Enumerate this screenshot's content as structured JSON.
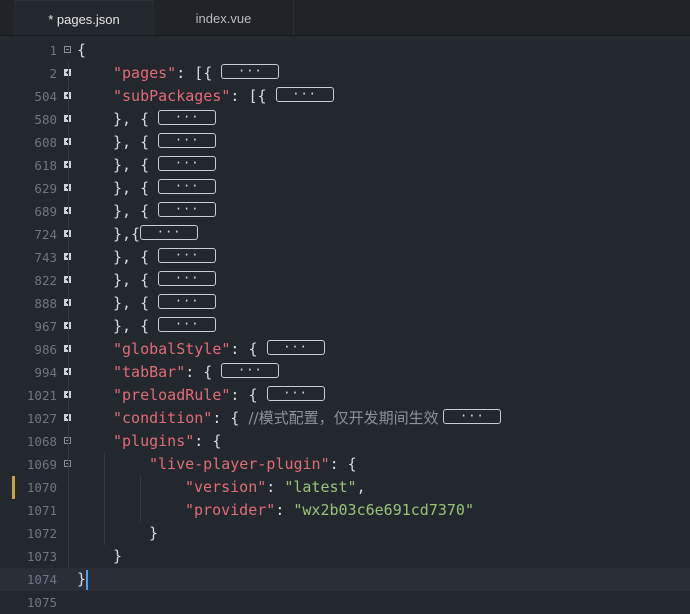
{
  "tabs": [
    {
      "label": "* pages.json",
      "active": true
    },
    {
      "label": "index.vue",
      "active": false
    }
  ],
  "colors": {
    "key": "#e06c75",
    "string": "#98c379",
    "comment": "#8b919b",
    "punct": "#d7dae0",
    "background": "#23272e"
  },
  "fold_placeholder": "···",
  "lines": [
    {
      "num": "1",
      "fold": "minus",
      "indent": 0,
      "parts": [
        {
          "t": "{",
          "c": "p"
        }
      ]
    },
    {
      "num": "2",
      "fold": "plus",
      "indent": 1,
      "parts": [
        {
          "t": "\"pages\"",
          "c": "k"
        },
        {
          "t": ": [{ ",
          "c": "p"
        },
        {
          "t": "···",
          "c": "pill"
        }
      ]
    },
    {
      "num": "504",
      "fold": "plus",
      "indent": 1,
      "parts": [
        {
          "t": "\"subPackages\"",
          "c": "k"
        },
        {
          "t": ": [{ ",
          "c": "p"
        },
        {
          "t": "···",
          "c": "pill"
        }
      ]
    },
    {
      "num": "580",
      "fold": "plus",
      "indent": 1,
      "parts": [
        {
          "t": "}, { ",
          "c": "p"
        },
        {
          "t": "···",
          "c": "pill"
        }
      ]
    },
    {
      "num": "608",
      "fold": "plus",
      "indent": 1,
      "parts": [
        {
          "t": "}, { ",
          "c": "p"
        },
        {
          "t": "···",
          "c": "pill"
        }
      ]
    },
    {
      "num": "618",
      "fold": "plus",
      "indent": 1,
      "parts": [
        {
          "t": "}, { ",
          "c": "p"
        },
        {
          "t": "···",
          "c": "pill"
        }
      ]
    },
    {
      "num": "629",
      "fold": "plus",
      "indent": 1,
      "parts": [
        {
          "t": "}, { ",
          "c": "p"
        },
        {
          "t": "···",
          "c": "pill"
        }
      ]
    },
    {
      "num": "689",
      "fold": "plus",
      "indent": 1,
      "parts": [
        {
          "t": "}, { ",
          "c": "p"
        },
        {
          "t": "···",
          "c": "pill"
        }
      ]
    },
    {
      "num": "724",
      "fold": "plus",
      "indent": 1,
      "parts": [
        {
          "t": "},{",
          "c": "p"
        },
        {
          "t": "···",
          "c": "pill"
        }
      ]
    },
    {
      "num": "743",
      "fold": "plus",
      "indent": 1,
      "parts": [
        {
          "t": "}, { ",
          "c": "p"
        },
        {
          "t": "···",
          "c": "pill"
        }
      ]
    },
    {
      "num": "822",
      "fold": "plus",
      "indent": 1,
      "parts": [
        {
          "t": "}, { ",
          "c": "p"
        },
        {
          "t": "···",
          "c": "pill"
        }
      ]
    },
    {
      "num": "888",
      "fold": "plus",
      "indent": 1,
      "parts": [
        {
          "t": "}, { ",
          "c": "p"
        },
        {
          "t": "···",
          "c": "pill"
        }
      ]
    },
    {
      "num": "967",
      "fold": "plus",
      "indent": 1,
      "parts": [
        {
          "t": "}, { ",
          "c": "p"
        },
        {
          "t": "···",
          "c": "pill"
        }
      ]
    },
    {
      "num": "986",
      "fold": "plus",
      "indent": 1,
      "parts": [
        {
          "t": "\"globalStyle\"",
          "c": "k"
        },
        {
          "t": ": { ",
          "c": "p"
        },
        {
          "t": "···",
          "c": "pill"
        }
      ]
    },
    {
      "num": "994",
      "fold": "plus",
      "indent": 1,
      "parts": [
        {
          "t": "\"tabBar\"",
          "c": "k"
        },
        {
          "t": ": { ",
          "c": "p"
        },
        {
          "t": "···",
          "c": "pill"
        }
      ]
    },
    {
      "num": "1021",
      "fold": "plus",
      "indent": 1,
      "parts": [
        {
          "t": "\"preloadRule\"",
          "c": "k"
        },
        {
          "t": ": { ",
          "c": "p"
        },
        {
          "t": "···",
          "c": "pill"
        }
      ]
    },
    {
      "num": "1027",
      "fold": "plus",
      "indent": 1,
      "parts": [
        {
          "t": "\"condition\"",
          "c": "k"
        },
        {
          "t": ": { ",
          "c": "p"
        },
        {
          "t": "//模式配置，仅开发期间生效 ",
          "c": "c"
        },
        {
          "t": "···",
          "c": "pill"
        }
      ]
    },
    {
      "num": "1068",
      "fold": "minus",
      "indent": 1,
      "parts": [
        {
          "t": "\"plugins\"",
          "c": "k"
        },
        {
          "t": ": {",
          "c": "p"
        }
      ]
    },
    {
      "num": "1069",
      "fold": "minus",
      "indent": 2,
      "parts": [
        {
          "t": "\"live-player-plugin\"",
          "c": "k"
        },
        {
          "t": ": {",
          "c": "p"
        }
      ]
    },
    {
      "num": "1070",
      "fold": "",
      "indent": 3,
      "modified": true,
      "parts": [
        {
          "t": "\"version\"",
          "c": "k"
        },
        {
          "t": ": ",
          "c": "p"
        },
        {
          "t": "\"latest\"",
          "c": "s"
        },
        {
          "t": ",",
          "c": "p"
        }
      ]
    },
    {
      "num": "1071",
      "fold": "",
      "indent": 3,
      "parts": [
        {
          "t": "\"provider\"",
          "c": "k"
        },
        {
          "t": ": ",
          "c": "p"
        },
        {
          "t": "\"wx2b03c6e691cd7370\"",
          "c": "s"
        }
      ]
    },
    {
      "num": "1072",
      "fold": "",
      "indent": 2,
      "parts": [
        {
          "t": "}",
          "c": "p"
        }
      ]
    },
    {
      "num": "1073",
      "fold": "",
      "indent": 1,
      "parts": [
        {
          "t": "}",
          "c": "p"
        }
      ]
    },
    {
      "num": "1074",
      "fold": "",
      "indent": 0,
      "current": true,
      "parts": [
        {
          "t": "}",
          "c": "p"
        }
      ]
    },
    {
      "num": "1075",
      "fold": "",
      "indent": 0,
      "parts": []
    }
  ]
}
